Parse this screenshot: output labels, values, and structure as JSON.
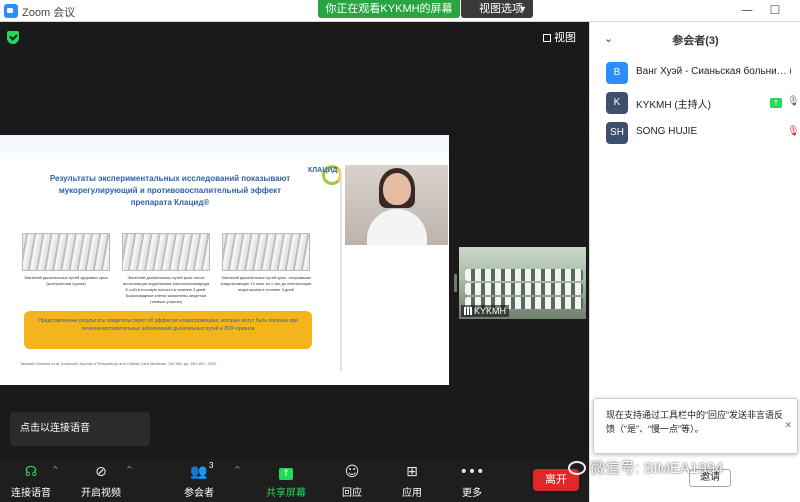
{
  "window": {
    "title": "Zoom 会议",
    "share_banner": "你正在观看KYKMH的屏幕",
    "view_options": "视图选项",
    "minimize": "—",
    "maximize": "☐",
    "close": "✕"
  },
  "meeting": {
    "view_label": "视图",
    "audio_tooltip": "点击以连接语音",
    "thumbnail_name": "KYKMH"
  },
  "slide": {
    "title_line1": "Результаты экспериментальных исследований показывают",
    "title_line2": "мукорегулирующий и противовоспалительный эффект",
    "title_line3": "препарата Клацид®",
    "brand": "КЛАЦИД",
    "captions": [
      "Эпителий дыхательных путей здоровых крыс (контрольная группа)",
      "Эпителий дыхательных путей крыс после инстилляции эндотоксина (липополисахарида E.coli) в носовую полость в течение 3 дней. Бокаловидные клетки заполнены секретом (темные участки)",
      "Эпителий дыхательных путей крыс, получавших кларитромицин 10 мг/кг за 1 час до инстилляции эндотоксина в течение 3 дней"
    ],
    "callout": "Представленные результаты свидетельствуют об эффектах кларитромицина, которые могут быть полезны при лечении воспалительных заболеваний дыхательных путей и ЛОР-органов",
    "footnote": "Tamaoki Shimizu et al. American Journal of Respiratory and Critical Care Medicine. Vol 158. pp. 691-697, 2000"
  },
  "toolbar": {
    "audio": "连接语音",
    "video": "开启视频",
    "participants": "参会者",
    "participants_count": "3",
    "share": "共享屏幕",
    "reactions": "回应",
    "apps": "应用",
    "more": "更多",
    "leave": "离开"
  },
  "panel": {
    "title": "参会者(3)",
    "participants": [
      {
        "initial": "B",
        "name": "Ванг Хуэй - Сианьская больни… (я)",
        "color": "#2d8cff"
      },
      {
        "initial": "K",
        "name": "KYKMH (主持人)",
        "color": "#3e4f6b"
      },
      {
        "initial": "SH",
        "name": "SONG HUJIE",
        "color": "#3e4f6b"
      }
    ]
  },
  "notice": {
    "text": "现在支持通过工具栏中的“回应”发送非言语反馈（“是”、“慢一点”等）。",
    "close": "✕"
  },
  "invite": "邀请",
  "watermark": "微信号: SIMEA1994",
  "colors": {
    "share_green": "#26a541",
    "leave_red": "#e02828",
    "zoom_blue": "#2d8cff"
  }
}
